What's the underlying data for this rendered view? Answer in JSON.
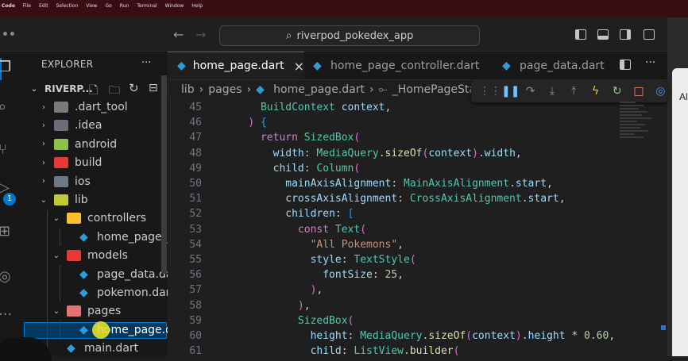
{
  "menubar": {
    "items": [
      "Code",
      "File",
      "Edit",
      "Selection",
      "View",
      "Go",
      "Run",
      "Terminal",
      "Window",
      "Help"
    ]
  },
  "titlebar": {
    "search_text": "riverpod_pokedex_app"
  },
  "activity": {
    "badge_count": "1"
  },
  "sidebar": {
    "title": "EXPLORER",
    "more": "···",
    "root": "RIVERP...",
    "items": [
      {
        "label": ".dart_tool",
        "type": "folder",
        "color": "#7a7a7a"
      },
      {
        "label": ".idea",
        "type": "folder",
        "color": "#6b6b7a"
      },
      {
        "label": "android",
        "type": "folder",
        "color": "#8bc34a"
      },
      {
        "label": "build",
        "type": "folder",
        "color": "#e53935"
      },
      {
        "label": "ios",
        "type": "folder",
        "color": "#6d7886"
      },
      {
        "label": "lib",
        "type": "folder-open",
        "color": "#c0ca33"
      },
      {
        "label": "controllers",
        "type": "folder-open",
        "color": "#fbc02d"
      },
      {
        "label": "home_page_c...",
        "type": "dart"
      },
      {
        "label": "models",
        "type": "folder-open",
        "color": "#e53935"
      },
      {
        "label": "page_data.dart",
        "type": "dart"
      },
      {
        "label": "pokemon.dart",
        "type": "dart"
      },
      {
        "label": "pages",
        "type": "folder-open",
        "color": "#e57373"
      },
      {
        "label": "home_page.d...",
        "type": "dart"
      },
      {
        "label": "main.dart",
        "type": "dart"
      }
    ]
  },
  "tabs": [
    {
      "label": "home_page.dart",
      "close": "×"
    },
    {
      "label": "home_page_controller.dart"
    },
    {
      "label": "page_data.dart"
    }
  ],
  "breadcrumb": [
    "lib",
    "pages",
    "home_page.dart",
    "_HomePageState"
  ],
  "debug_toolbar": {
    "icons": [
      "drag-handle-icon",
      "pause-icon",
      "step-over-icon",
      "step-into-icon",
      "step-out-icon",
      "hot-reload-icon",
      "restart-icon",
      "stop-icon",
      "devtools-icon"
    ],
    "colors": {
      "pause": "#75beff",
      "reload": "#ffcc00",
      "restart": "#89d185",
      "stop": "#f48771",
      "devtools": "#3794ff"
    }
  },
  "editor": {
    "lines": [
      {
        "n": "45",
        "t": "      BuildContext context,"
      },
      {
        "n": "46",
        "t": "    ) {"
      },
      {
        "n": "47",
        "t": "      return SizedBox("
      },
      {
        "n": "48",
        "t": "        width: MediaQuery.sizeOf(context).width,"
      },
      {
        "n": "49",
        "t": "        child: Column("
      },
      {
        "n": "50",
        "t": "          mainAxisAlignment: MainAxisAlignment.start,"
      },
      {
        "n": "51",
        "t": "          crossAxisAlignment: CrossAxisAlignment.start,"
      },
      {
        "n": "52",
        "t": "          children: ["
      },
      {
        "n": "53",
        "t": "            const Text("
      },
      {
        "n": "54",
        "t": "              \"All Pokemons\","
      },
      {
        "n": "55",
        "t": "              style: TextStyle("
      },
      {
        "n": "56",
        "t": "                fontSize: 25,"
      },
      {
        "n": "57",
        "t": "              ),"
      },
      {
        "n": "58",
        "t": "            ),"
      },
      {
        "n": "59",
        "t": "            SizedBox("
      },
      {
        "n": "60",
        "t": "              height: MediaQuery.sizeOf(context).height * 0.60,"
      },
      {
        "n": "61",
        "t": "              child: ListView.builder("
      }
    ]
  },
  "right_panel": {
    "text": "Al"
  }
}
